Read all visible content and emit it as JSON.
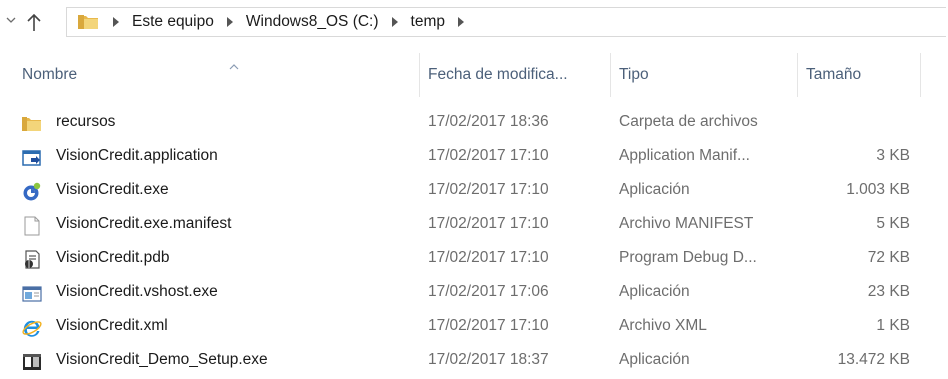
{
  "address_bar": {
    "breadcrumbs": [
      "Este equipo",
      "Windows8_OS (C:)",
      "temp"
    ],
    "folder_icon": "folder-icon",
    "nav_icons": [
      "recent-locations-icon",
      "up-arrow-icon"
    ]
  },
  "columns": {
    "name": "Nombre",
    "date": "Fecha de modifica...",
    "type": "Tipo",
    "size": "Tamaño"
  },
  "files": [
    {
      "name": "recursos",
      "date": "17/02/2017 18:36",
      "type": "Carpeta de archivos",
      "size": "",
      "icon": "folder-icon"
    },
    {
      "name": "VisionCredit.application",
      "date": "17/02/2017 17:10",
      "type": "Application Manif...",
      "size": "3 KB",
      "icon": "application-manifest-icon"
    },
    {
      "name": "VisionCredit.exe",
      "date": "17/02/2017 17:10",
      "type": "Aplicación",
      "size": "1.003 KB",
      "icon": "app-exe-icon"
    },
    {
      "name": "VisionCredit.exe.manifest",
      "date": "17/02/2017 17:10",
      "type": "Archivo MANIFEST",
      "size": "5 KB",
      "icon": "blank-file-icon"
    },
    {
      "name": "VisionCredit.pdb",
      "date": "17/02/2017 17:10",
      "type": "Program Debug D...",
      "size": "72 KB",
      "icon": "debug-file-icon"
    },
    {
      "name": "VisionCredit.vshost.exe",
      "date": "17/02/2017 17:06",
      "type": "Aplicación",
      "size": "23 KB",
      "icon": "window-exe-icon"
    },
    {
      "name": "VisionCredit.xml",
      "date": "17/02/2017 17:10",
      "type": "Archivo XML",
      "size": "1 KB",
      "icon": "internet-explorer-icon"
    },
    {
      "name": "VisionCredit_Demo_Setup.exe",
      "date": "17/02/2017 18:37",
      "type": "Aplicación",
      "size": "13.472 KB",
      "icon": "setup-exe-icon"
    }
  ],
  "colors": {
    "header_text": "#4c607a",
    "folder_yellow": "#e8b84b",
    "detail_text": "#6d6d6d"
  }
}
